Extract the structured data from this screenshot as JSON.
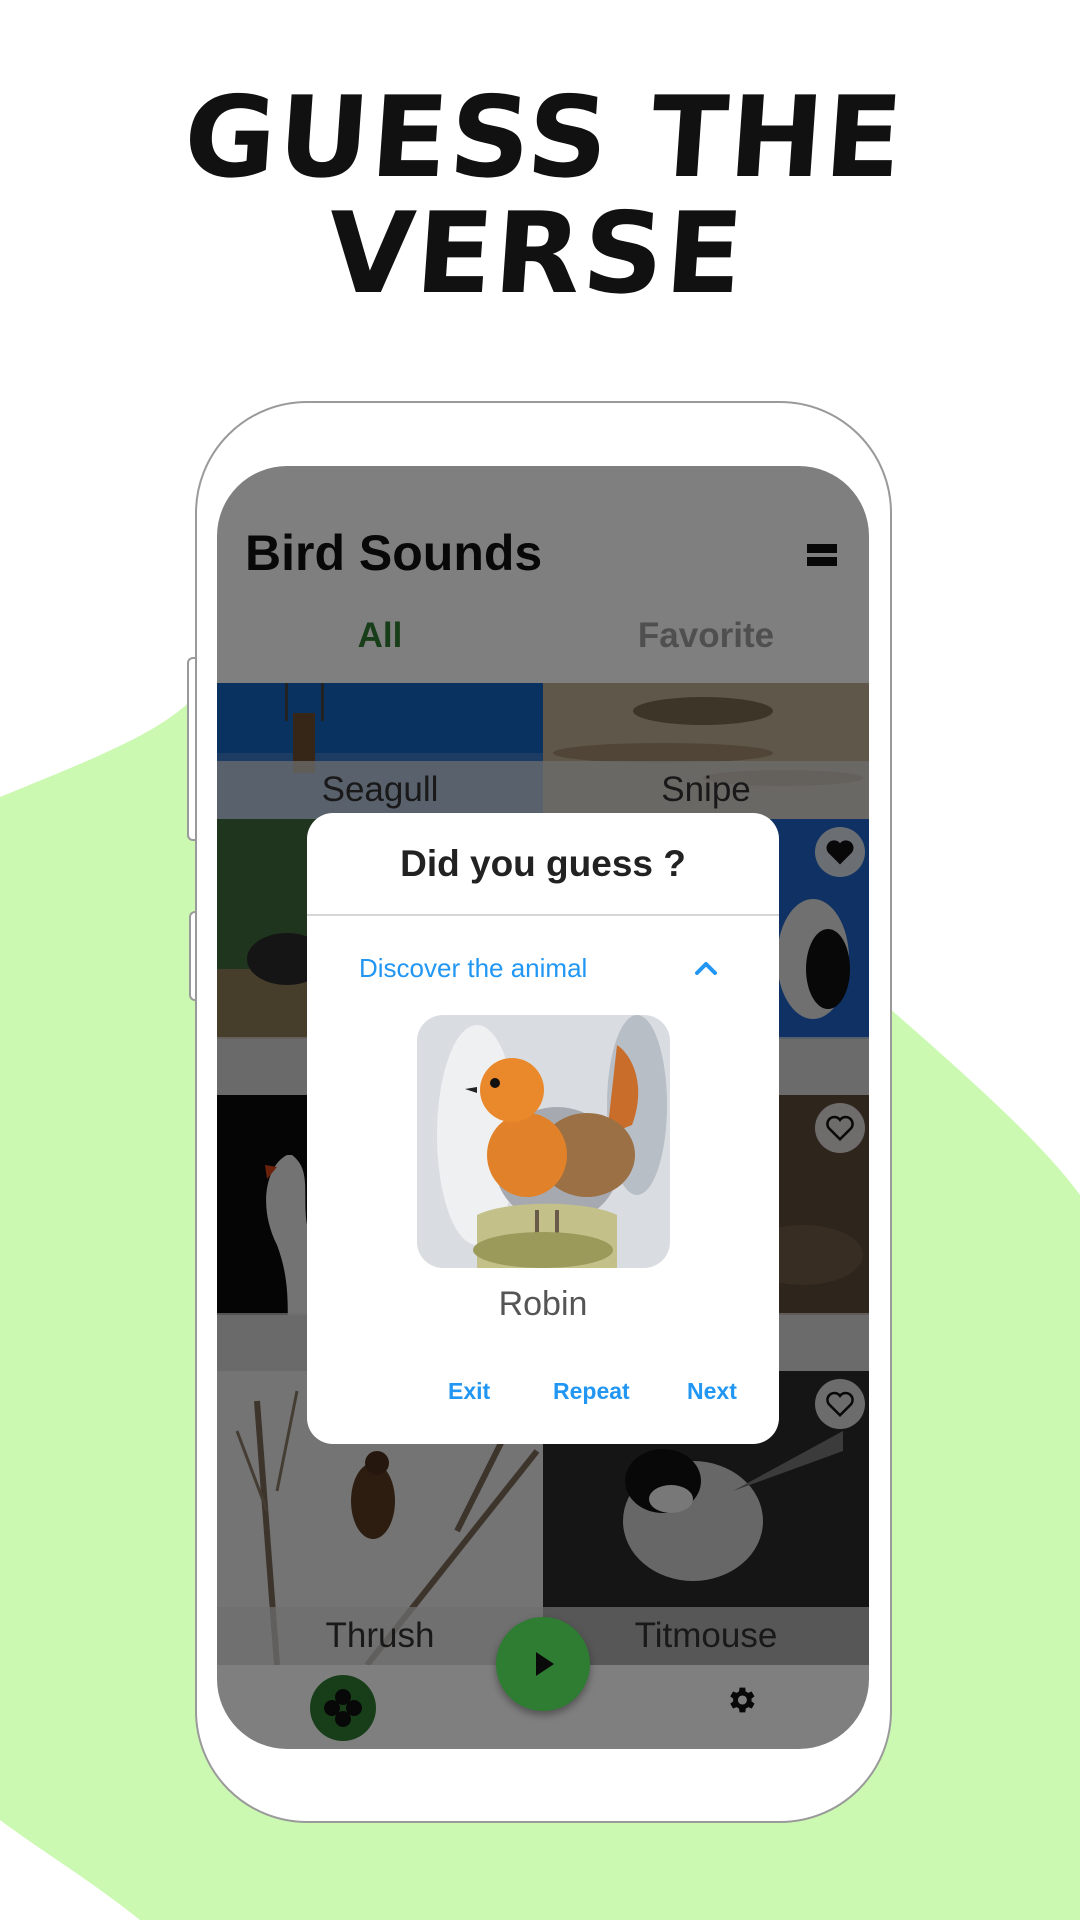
{
  "headline": {
    "line1": "GUESS THE",
    "line2": "VERSE"
  },
  "app": {
    "title": "Bird Sounds",
    "tabs": [
      {
        "label": "All"
      },
      {
        "label": "Favorite"
      }
    ]
  },
  "grid": {
    "tiles": [
      {
        "caption": "Seagull"
      },
      {
        "caption": "Snipe"
      },
      {
        "caption": ""
      },
      {
        "caption": ""
      },
      {
        "caption": ""
      },
      {
        "caption": ""
      },
      {
        "caption": "Thrush"
      },
      {
        "caption": "Titmouse"
      }
    ]
  },
  "dialog": {
    "title": "Did you guess ?",
    "discover_label": "Discover the animal",
    "animal_name": "Robin",
    "buttons": {
      "exit": "Exit",
      "repeat": "Repeat",
      "next": "Next"
    }
  },
  "colors": {
    "accent_green": "#2e7d32",
    "link_blue": "#2196f3",
    "background_blob": "#ccf9b2"
  },
  "icons": {
    "menu": "menu-icon",
    "heart": "heart-icon",
    "gamepad": "gamepad-icon",
    "play": "play-icon",
    "settings": "gear-icon",
    "chevron": "chevron-up-icon"
  }
}
